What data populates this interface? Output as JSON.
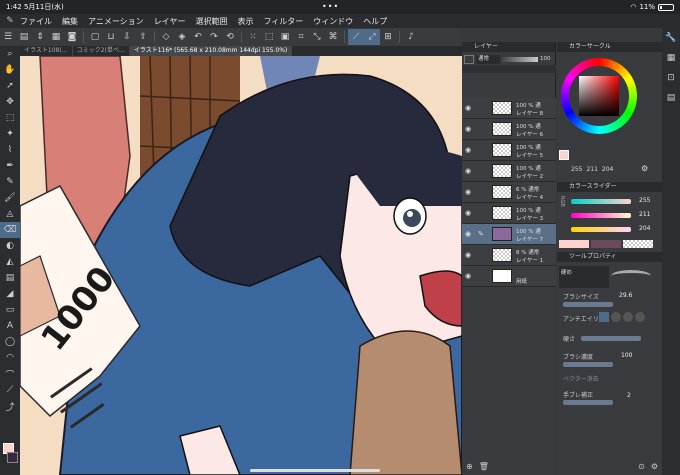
{
  "status": {
    "time": "1:42",
    "date": "5月11日(水)",
    "battery": "11%"
  },
  "menu": [
    "ファイル",
    "編集",
    "アニメーション",
    "レイヤー",
    "選択範囲",
    "表示",
    "フィルター",
    "ウィンドウ",
    "ヘルプ"
  ],
  "tabs": [
    "イラスト108(…",
    "コミック2(単ペ…",
    "イラスト116* (565.68 x 210.08mm 144dpi 155.0%)"
  ],
  "layer_panel": {
    "title": "レイヤー",
    "blend_mode": "通常",
    "opacity": "100",
    "layers": [
      {
        "line1": "100 % 通",
        "line2": "レイヤー 8"
      },
      {
        "line1": "100 % 通",
        "line2": "レイヤー 6"
      },
      {
        "line1": "100 % 通",
        "line2": "レイヤー 5"
      },
      {
        "line1": "100 % 通",
        "line2": "レイヤー 2"
      },
      {
        "line1": "6 % 通常",
        "line2": "レイヤー 4"
      },
      {
        "line1": "100 % 通",
        "line2": "レイヤー 3"
      },
      {
        "line1": "100 % 通",
        "line2": "レイヤー 7"
      },
      {
        "line1": "8 % 通常",
        "line2": "レイヤー 1"
      },
      {
        "line1": "",
        "line2": "用紙"
      }
    ]
  },
  "color_circle": {
    "title": "カラーサークル",
    "h": "255",
    "s": "211",
    "v": "204"
  },
  "color_slider": {
    "title": "カラースライダー",
    "mode": "RGB",
    "r": "255",
    "g": "211",
    "b": "204"
  },
  "tool_property": {
    "title": "ツールプロパティ",
    "tool": "硬め",
    "brush_size_label": "ブラシサイズ",
    "brush_size": "29.6",
    "antialias_label": "アンチエイリ",
    "hardness_label": "硬さ",
    "density_label": "ブラシ濃度",
    "density": "100",
    "vector_label": "ベクター消去",
    "stabilize_label": "手ブレ補正",
    "stabilize": "2"
  },
  "canvas_text": "1000",
  "colors": {
    "accent": "#4f6b8a",
    "fg": "#ffd3cc"
  }
}
